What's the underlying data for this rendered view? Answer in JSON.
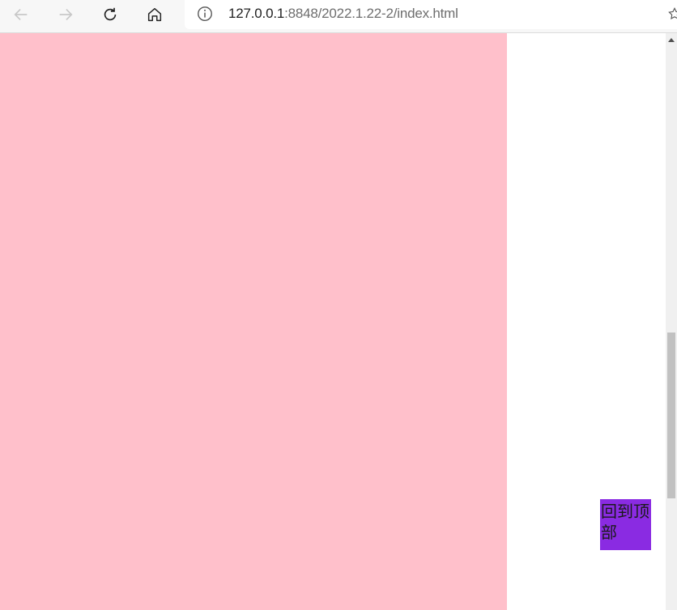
{
  "browser": {
    "url_host": "127.0.0.1",
    "url_rest": ":8848/2022.1.22-2/index.html",
    "icons": [
      "back-arrow-icon",
      "forward-arrow-icon",
      "reload-icon",
      "home-icon",
      "info-icon",
      "star-icon"
    ]
  },
  "page": {
    "block_color": "#ffc0cb",
    "back_to_top": {
      "label": "回到顶部",
      "color": "#8a2be2"
    }
  },
  "scrollbar": {
    "position_fraction": 0.72
  }
}
